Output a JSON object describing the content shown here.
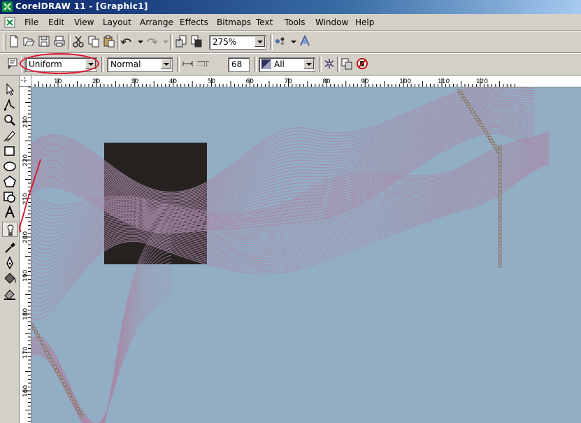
{
  "window": {
    "title": "CorelDRAW 11 - [Graphic1]"
  },
  "menu": {
    "items": [
      "File",
      "Edit",
      "View",
      "Layout",
      "Arrange",
      "Effects",
      "Bitmaps",
      "Text",
      "Tools",
      "Window",
      "Help"
    ]
  },
  "standard_toolbar": {
    "zoom_value": "275%",
    "buttons": [
      "new-document-icon",
      "open-icon",
      "save-icon",
      "print-icon",
      "cut-icon",
      "copy-icon",
      "paste-icon",
      "undo-icon",
      "redo-icon",
      "import-icon",
      "export-icon",
      "application-launcher-icon",
      "corel-online-icon"
    ]
  },
  "property_bar": {
    "transparency_type": "Uniform",
    "merge_mode": "Normal",
    "transparency_value": "68",
    "target": "All"
  },
  "toolbox": {
    "tools": [
      "pick-tool-icon",
      "shape-tool-icon",
      "zoom-tool-icon",
      "freehand-tool-icon",
      "rectangle-tool-icon",
      "ellipse-tool-icon",
      "polygon-tool-icon",
      "basic-shapes-icon",
      "text-tool-icon",
      "interactive-transparency-tool-icon",
      "eyedropper-tool-icon",
      "outline-tool-icon",
      "fill-tool-icon",
      "interactive-fill-icon"
    ],
    "active_tool": "interactive-transparency-tool-icon"
  },
  "rulers": {
    "horizontal_labels": [
      "10",
      "20",
      "30",
      "40",
      "50",
      "60",
      "70",
      "80",
      "90",
      "100",
      "110",
      "120"
    ],
    "vertical_labels": [
      "230",
      "220",
      "210",
      "200",
      "190",
      "180",
      "170",
      "160"
    ]
  },
  "canvas": {
    "background_color": "#92aec4",
    "blend_line_color": "#a88aa8",
    "rectangle_color": "#262220",
    "handle_color": "#8a7060"
  },
  "annotation": {
    "color": "#e0102a"
  }
}
